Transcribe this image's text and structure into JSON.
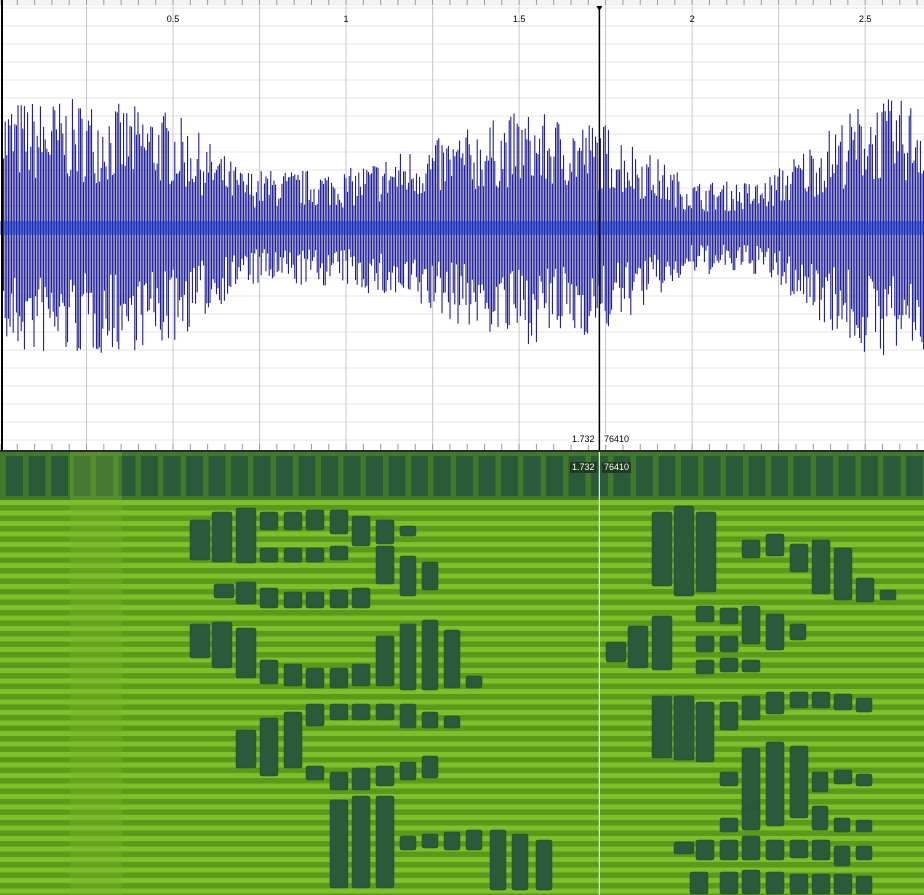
{
  "timeline": {
    "tick_labels": [
      "0.5",
      "1",
      "1.5",
      "2",
      "2.5"
    ],
    "tick_values": [
      0.5,
      1.0,
      1.5,
      2.0,
      2.5
    ],
    "visible_range_seconds": [
      0,
      2.67
    ]
  },
  "cursor": {
    "time_label": "1.732",
    "sample_label": "76410",
    "time_seconds": 1.732
  },
  "colors": {
    "waveform": "#0a0a8a",
    "waveform_core": "#1a3acc",
    "grid": "#c8c8c8",
    "spectrogram_bg": "#5a9a1a",
    "spectrogram_stripe": "#7fbf2a",
    "spectrogram_block": "#2a5a3a",
    "cursor_line": "#000000"
  },
  "waveform": {
    "envelope_keyframes_seconds": [
      0,
      0.25,
      0.5,
      0.7,
      1.0,
      1.2,
      1.5,
      1.75,
      2.0,
      2.2,
      2.5,
      2.67
    ],
    "envelope_levels": [
      0.55,
      0.55,
      0.5,
      0.25,
      0.25,
      0.35,
      0.5,
      0.45,
      0.2,
      0.2,
      0.55,
      0.55
    ]
  }
}
